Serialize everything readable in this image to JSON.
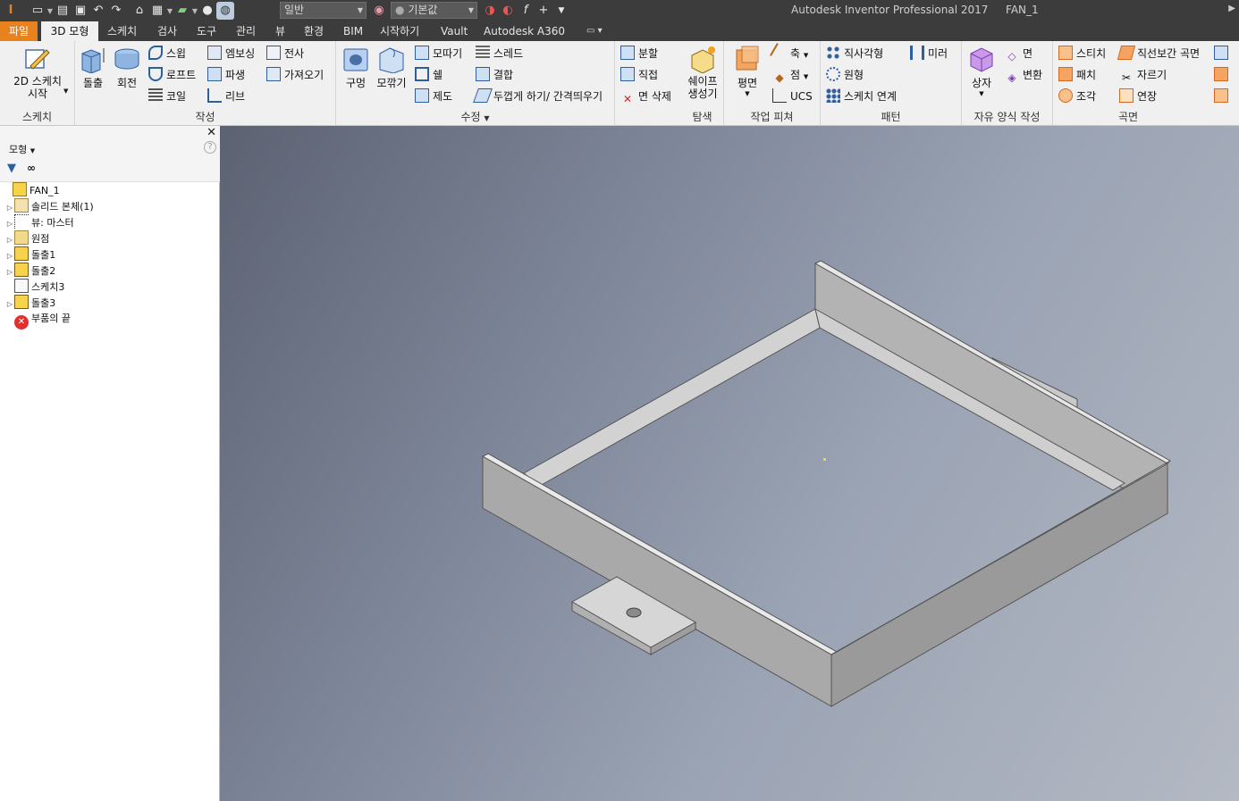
{
  "app": {
    "title": "Autodesk Inventor Professional 2017",
    "document": "FAN_1"
  },
  "quick_access": {
    "material_combo": "일반",
    "appearance_combo": "기본값"
  },
  "tabs": [
    {
      "label": "파일"
    },
    {
      "label": "3D 모형"
    },
    {
      "label": "스케치"
    },
    {
      "label": "검사"
    },
    {
      "label": "도구"
    },
    {
      "label": "관리"
    },
    {
      "label": "뷰"
    },
    {
      "label": "환경"
    },
    {
      "label": "BIM"
    },
    {
      "label": "시작하기"
    },
    {
      "label": "Vault"
    },
    {
      "label": "Autodesk A360"
    }
  ],
  "ribbon": {
    "sketch": {
      "title": "스케치",
      "start_sketch": "2D 스케치\n시작"
    },
    "create": {
      "title": "작성",
      "extrude": "돌출",
      "revolve": "회전",
      "sweep": "스윕",
      "loft": "로프트",
      "coil": "코일",
      "emboss": "엠보싱",
      "derive": "파생",
      "rib": "리브",
      "decal": "전사",
      "import": "가져오기"
    },
    "modify": {
      "title": "수정",
      "hole": "구멍",
      "fillet": "모깎기",
      "chamfer": "모따기",
      "shell": "쉘",
      "draft": "제도",
      "thread": "스레드",
      "combine": "결합",
      "thicken": "두껍게 하기/ 간격띄우기",
      "split": "분할",
      "direct": "직접",
      "delete_face": "면 삭제"
    },
    "explore": {
      "title": "탐색",
      "shape_generator": "쉐이프\n생성기"
    },
    "work_features": {
      "title": "작업 피쳐",
      "plane": "평면",
      "axis": "축",
      "point": "점",
      "ucs": "UCS"
    },
    "pattern": {
      "title": "패턴",
      "rectangular": "직사각형",
      "circular": "원형",
      "sketch_driven": "스케치 연계",
      "mirror": "미러"
    },
    "freeform": {
      "title": "자유 양식 작성",
      "box": "상자",
      "face": "면",
      "convert": "변환"
    },
    "surface": {
      "title": "곡면",
      "stitch": "스티치",
      "patch": "패치",
      "sculpt": "조각",
      "ruled": "직선보간 곡면",
      "trim": "자르기",
      "extend": "연장"
    }
  },
  "browser": {
    "header": "모형",
    "items": [
      {
        "label": "FAN_1"
      },
      {
        "label": "솔리드 본체(1)"
      },
      {
        "label": "뷰: 마스터"
      },
      {
        "label": "원점"
      },
      {
        "label": "돌출1"
      },
      {
        "label": "돌출2"
      },
      {
        "label": "스케치3"
      },
      {
        "label": "돌출3"
      },
      {
        "label": "부품의 끝"
      }
    ]
  },
  "colors": {
    "file_tab": "#e8821e",
    "titlebar": "#3c3c3c",
    "ribbon_bg": "#f0f0f0",
    "part_face": "#c8c8c8"
  }
}
